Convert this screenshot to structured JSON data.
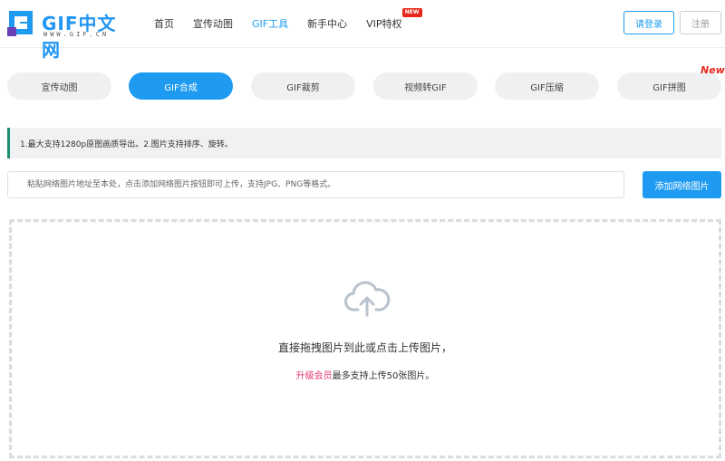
{
  "logo": {
    "text": "GIF中文网",
    "subtext": "WWW.GIF.CN"
  },
  "nav": {
    "items": [
      {
        "label": "首页",
        "active": false
      },
      {
        "label": "宣传动图",
        "active": false
      },
      {
        "label": "GIF工具",
        "active": true
      },
      {
        "label": "新手中心",
        "active": false
      },
      {
        "label": "VIP特权",
        "active": false,
        "badge": "NEW"
      }
    ]
  },
  "auth": {
    "login_label": "请登录",
    "register_label": "注册"
  },
  "tabs": {
    "items": [
      {
        "label": "宣传动图",
        "active": false
      },
      {
        "label": "GIF合成",
        "active": true
      },
      {
        "label": "GIF裁剪",
        "active": false
      },
      {
        "label": "视频转GIF",
        "active": false
      },
      {
        "label": "GIF压缩",
        "active": false
      },
      {
        "label": "GIF拼图",
        "active": false
      }
    ],
    "new_badge": "New"
  },
  "tip": {
    "text": "1.最大支持1280p原图画质导出。2.图片支持排序、旋转。"
  },
  "url_input": {
    "placeholder": "粘贴网络图片地址至本处，点击添加网络图片按钮即可上传，支持JPG、PNG等格式。",
    "value": ""
  },
  "add_button": {
    "label": "添加网络图片"
  },
  "dropzone": {
    "main_text": "直接拖拽图片到此或点击上传图片，",
    "vip_link": "升级会员",
    "sub_text": "最多支持上传50张图片。"
  },
  "colors": {
    "accent": "#1e9bf0",
    "badge_red": "#e5281a",
    "vip_pink": "#e5366c",
    "tip_border": "#1e8e73"
  }
}
